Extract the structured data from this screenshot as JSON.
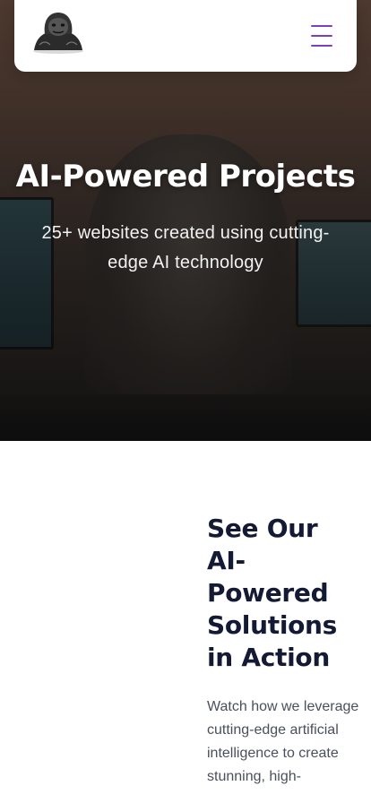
{
  "colors": {
    "menu_accent": "#7b3fbf",
    "heading_dark": "#141a33",
    "body_text": "#4a4f5c",
    "hero_text": "#ffffff"
  },
  "header": {
    "logo_icon": "gorilla-logo-icon",
    "menu_icon": "hamburger-menu-icon"
  },
  "hero": {
    "title": "AI-Powered Projects",
    "subtitle": "25+ websites created using cutting-edge AI technology"
  },
  "showcase": {
    "title": "See Our AI-Powered Solutions in Action",
    "description": "Watch how we leverage cutting-edge artificial intelligence to create stunning, high-"
  }
}
